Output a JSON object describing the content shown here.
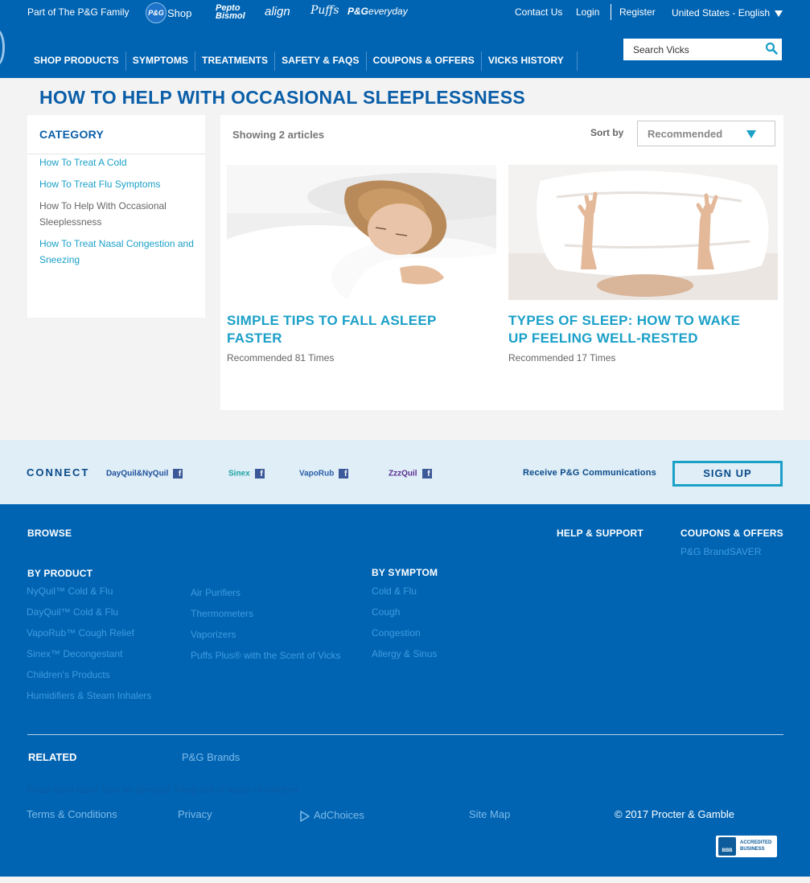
{
  "header": {
    "family_text": "Part of The P&G Family",
    "brands": {
      "pgshop_mark": "P&G",
      "pgshop_word": "Shop",
      "pepto_line1": "Pepto",
      "pepto_line2": "Bismol",
      "align": "align",
      "puffs": "Puffs",
      "pgeveryday_mark": "P&G",
      "pgeveryday_word": "everyday"
    },
    "top_links": {
      "contact": "Contact Us",
      "login": "Login",
      "register": "Register",
      "locale": "United States - English"
    },
    "nav": [
      "SHOP PRODUCTS",
      "SYMPTOMS",
      "TREATMENTS",
      "SAFETY & FAQS",
      "COUPONS & OFFERS",
      "VICKS HISTORY"
    ],
    "search": {
      "placeholder": "Search Vicks",
      "value": ""
    }
  },
  "page_title": "HOW TO HELP WITH OCCASIONAL SLEEPLESSNESS",
  "sidebar": {
    "heading": "CATEGORY",
    "items": [
      {
        "label": "How To Treat A Cold",
        "active": false
      },
      {
        "label": "How To Treat Flu Symptoms",
        "active": false
      },
      {
        "label": "How To Help With Occasional Sleeplessness",
        "active": true
      },
      {
        "label": "How To Treat Nasal Congestion and Sneezing",
        "active": false
      }
    ]
  },
  "articles": {
    "count_text": "Showing 2 articles",
    "sort_label": "Sort by",
    "sort_value": "Recommended",
    "items": [
      {
        "title": "SIMPLE TIPS TO FALL ASLEEP FASTER",
        "meta": "Recommended 81 Times"
      },
      {
        "title": "TYPES OF SLEEP: HOW TO WAKE UP FEELING WELL-RESTED",
        "meta": "Recommended 17 Times"
      }
    ]
  },
  "connect": {
    "label": "CONNECT",
    "brands": [
      "DayQuil&NyQuil",
      "Sinex",
      "VapoRub",
      "ZzzQuil"
    ],
    "fb_glyph": "f",
    "receive_text": "Receive P&G Communications",
    "signup_label": "SIGN UP"
  },
  "footer": {
    "browse": "BROWSE",
    "help_support": "HELP & SUPPORT",
    "coupons_offers": "COUPONS & OFFERS",
    "brandsaver": "P&G BrandSAVER",
    "by_product": "BY PRODUCT",
    "by_symptom": "BY SYMPTOM",
    "product_links_col1": [
      "NyQuil™ Cold & Flu",
      "DayQuil™ Cold & Flu",
      "VapoRub™ Cough Relief",
      "Sinex™ Decongestant",
      "Children's Products",
      "Humidifiers & Steam Inhalers"
    ],
    "product_links_col2": [
      "Air Purifiers",
      "Thermometers",
      "Vaporizers",
      "Puffs Plus® with the Scent of Vicks"
    ],
    "symptom_links": [
      "Cold & Flu",
      "Cough",
      "Congestion",
      "Allergy & Sinus"
    ],
    "related": "RELATED",
    "pg_brands": "P&G Brands",
    "disclaimer": "Read each label. Use as directed. Keep out of reach of children.",
    "legal": {
      "terms": "Terms & Conditions",
      "privacy": "Privacy",
      "adchoices": "AdChoices",
      "sitemap": "Site Map",
      "copyright": "© 2017 Procter & Gamble"
    },
    "bbb": {
      "mark": "BBB",
      "line1": "ACCREDITED",
      "line2": "BUSINESS"
    }
  },
  "colors": {
    "header_blue": "#0064b3",
    "title_blue": "#0a5ea8",
    "link_teal": "#1ba0c8",
    "connect_band": "#dfeef7"
  }
}
